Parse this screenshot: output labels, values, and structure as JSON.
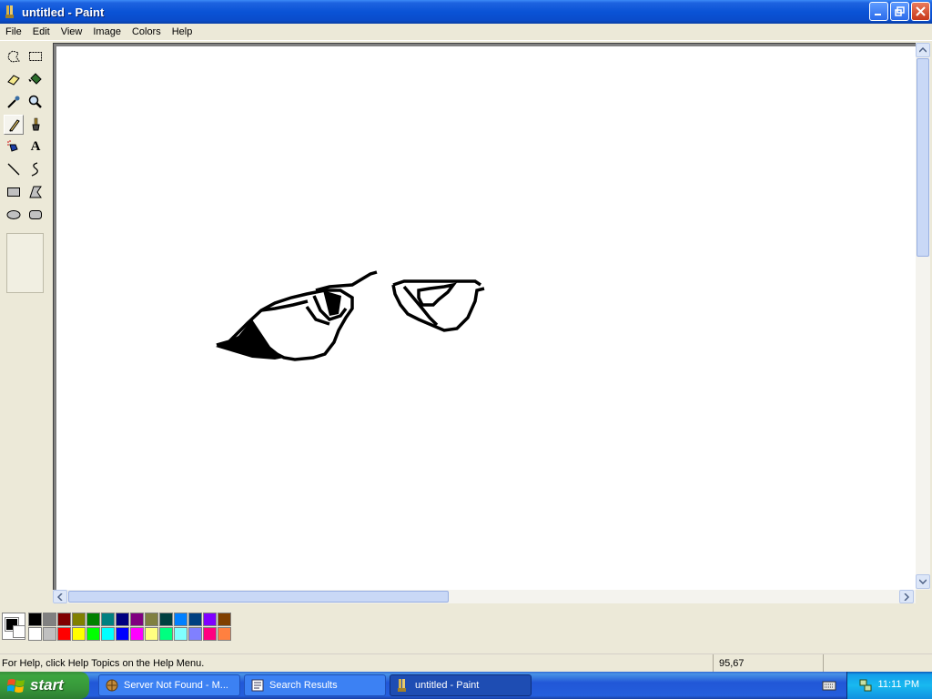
{
  "window": {
    "title": "untitled - Paint"
  },
  "menu": [
    "File",
    "Edit",
    "View",
    "Image",
    "Colors",
    "Help"
  ],
  "tools": [
    {
      "name": "free-form-select-icon"
    },
    {
      "name": "select-icon"
    },
    {
      "name": "eraser-icon"
    },
    {
      "name": "fill-icon"
    },
    {
      "name": "pick-color-icon"
    },
    {
      "name": "magnifier-icon"
    },
    {
      "name": "pencil-icon",
      "active": true
    },
    {
      "name": "brush-icon"
    },
    {
      "name": "airbrush-icon"
    },
    {
      "name": "text-icon",
      "glyph": "A"
    },
    {
      "name": "line-icon"
    },
    {
      "name": "curve-icon"
    },
    {
      "name": "rectangle-icon"
    },
    {
      "name": "polygon-icon"
    },
    {
      "name": "ellipse-icon"
    },
    {
      "name": "rounded-rectangle-icon"
    }
  ],
  "palette": {
    "foreground": "#000000",
    "background": "#FFFFFF",
    "top_row": [
      "#000000",
      "#808080",
      "#800000",
      "#808000",
      "#008000",
      "#008080",
      "#000080",
      "#800080",
      "#808040",
      "#004040",
      "#0080FF",
      "#004080",
      "#8000FF",
      "#804000"
    ],
    "bottom_row": [
      "#FFFFFF",
      "#C0C0C0",
      "#FF0000",
      "#FFFF00",
      "#00FF00",
      "#00FFFF",
      "#0000FF",
      "#FF00FF",
      "#FFFF80",
      "#00FF80",
      "#80FFFF",
      "#8080FF",
      "#FF0080",
      "#FF8040"
    ]
  },
  "status": {
    "help_text": "For Help, click Help Topics on the Help Menu.",
    "coords": "95,67"
  },
  "taskbar": {
    "start_label": "start",
    "tasks": [
      {
        "label": "Server Not Found - M..."
      },
      {
        "label": "Search Results"
      },
      {
        "label": "untitled - Paint",
        "active": true
      }
    ],
    "clock": "11:11 PM"
  }
}
